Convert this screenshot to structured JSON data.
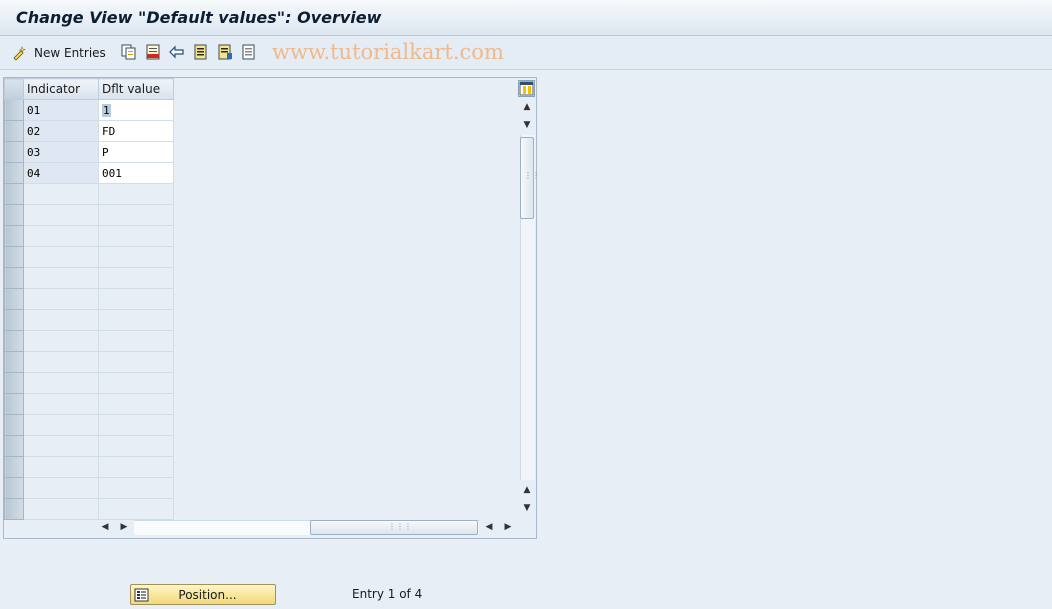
{
  "window": {
    "title": "Change View \"Default values\": Overview"
  },
  "toolbar": {
    "new_entries_label": "New Entries",
    "icons": [
      "new-entries-icon",
      "copy-icon",
      "delete-icon",
      "undo-change-icon",
      "select-all-icon",
      "select-block-icon",
      "deselect-all-icon"
    ]
  },
  "watermark": "www.tutorialkart.com",
  "table": {
    "columns": [
      "Indicator",
      "Dflt value"
    ],
    "rows": [
      {
        "indicator": "01",
        "value": "1"
      },
      {
        "indicator": "02",
        "value": "FD"
      },
      {
        "indicator": "03",
        "value": "P"
      },
      {
        "indicator": "04",
        "value": "001"
      }
    ]
  },
  "footer": {
    "position_button": "Position...",
    "entry_info": "Entry 1 of 4"
  },
  "colors": {
    "accent_button": "#f1d87a",
    "background": "#e7eef6"
  }
}
